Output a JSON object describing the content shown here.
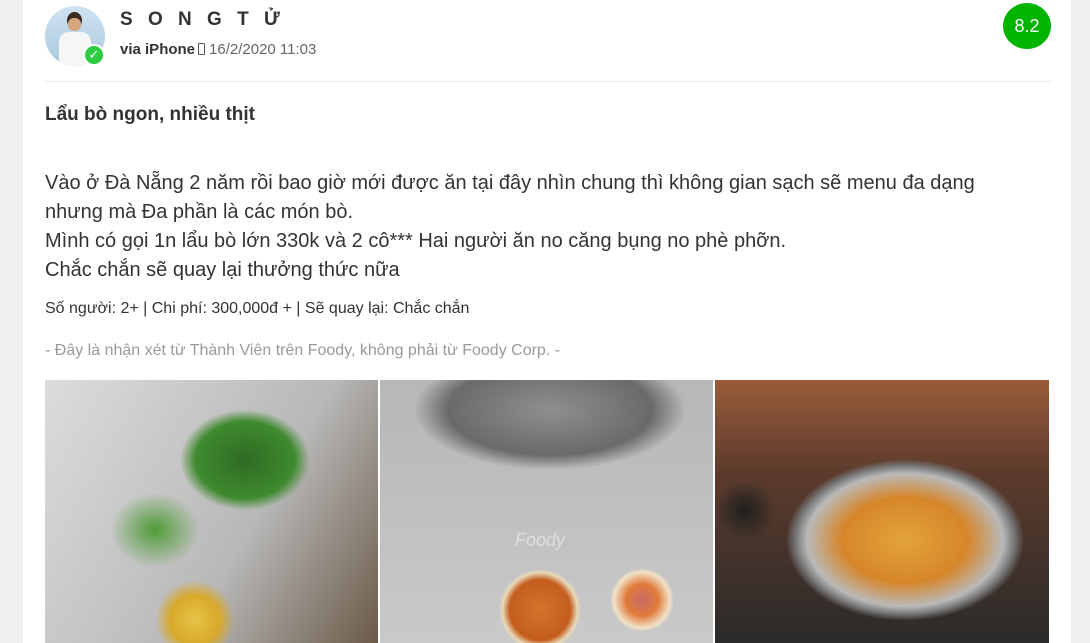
{
  "review": {
    "username": "S O N G T Ử",
    "device": "via iPhone",
    "date": "16/2/2020 11:03",
    "score": "8.2",
    "title": "Lẩu bò ngon, nhiều thịt",
    "body_lines": [
      "Vào ở Đà Nẵng 2 năm rồi bao giờ mới được ăn tại đây nhìn chung thì không gian sạch sẽ menu đa dạng",
      "nhưng mà Đa phần là các món bò.",
      "Mình có gọi 1n lẩu bò lớn 330k và 2 cô*** Hai người ăn no căng bụng no phè phỡn.",
      "Chắc chắn sẽ quay lại thưởng thức nữa"
    ],
    "stats": "Số người: 2+ | Chi phí: 300,000đ + | Sẽ quay lại: Chắc chắn",
    "disclaimer": "- Đây là nhận xét từ Thành Viên trên Foody, không phải từ Foody Corp. -",
    "photos": [
      {
        "name": "photo-vegetables-noodles"
      },
      {
        "name": "photo-dipping-sauce",
        "watermark": "Foody"
      },
      {
        "name": "photo-beef-hotpot"
      }
    ]
  },
  "colors": {
    "score_badge": "#00b400",
    "verified_badge": "#2ecc40",
    "disclaimer_text": "#999999"
  },
  "icons": {
    "verified": "check-icon",
    "device": "phone-icon"
  }
}
